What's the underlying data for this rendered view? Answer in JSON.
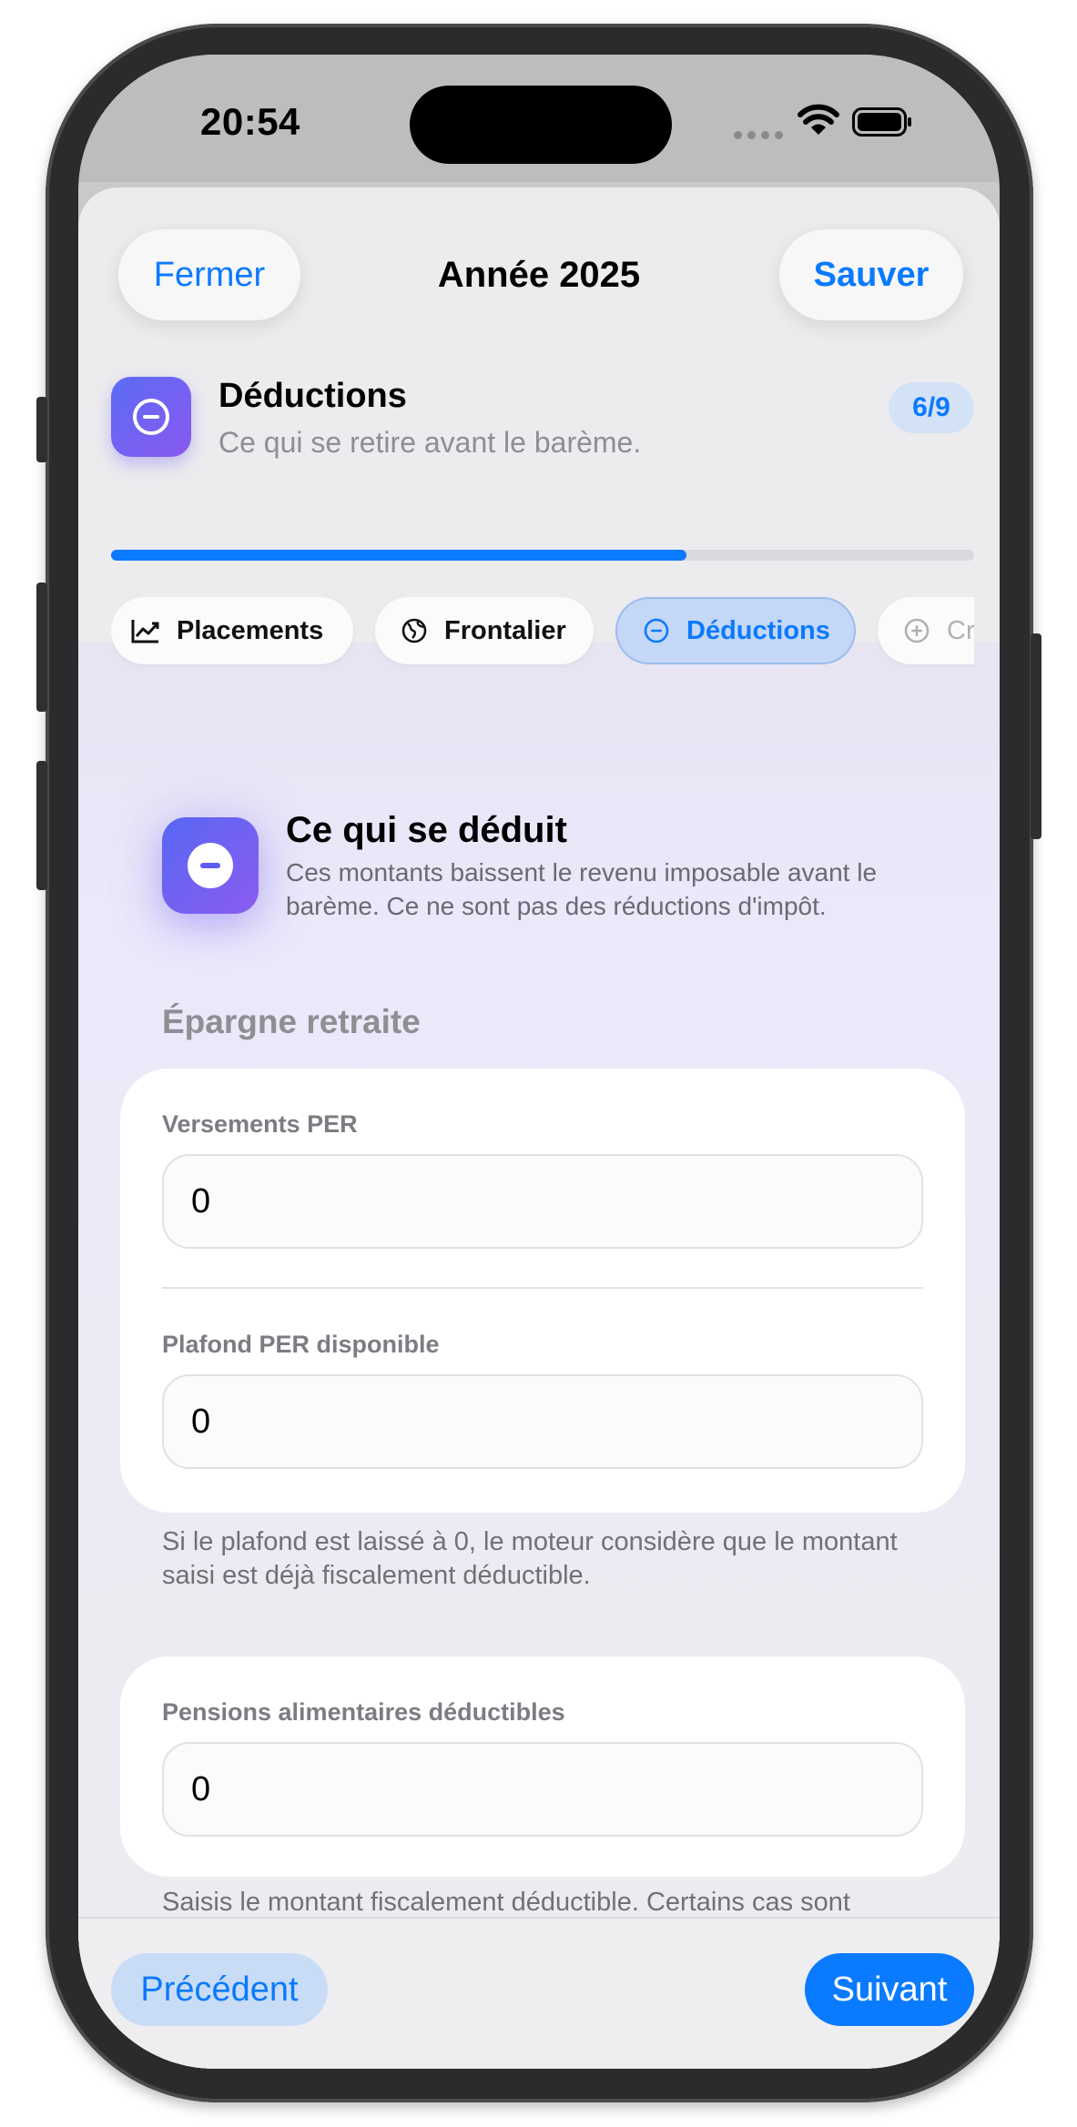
{
  "status_bar": {
    "time": "20:54"
  },
  "header": {
    "close_label": "Fermer",
    "title": "Année 2025",
    "save_label": "Sauver"
  },
  "section": {
    "title": "Déductions",
    "subtitle": "Ce qui se retire avant le barème.",
    "step_badge": "6/9",
    "progress": 0.667
  },
  "tabs": [
    {
      "label": "Placements",
      "icon": "chart-icon"
    },
    {
      "label": "Frontalier",
      "icon": "globe-icon"
    },
    {
      "label": "Déductions",
      "icon": "minus-circle-icon",
      "active": true
    },
    {
      "label": "Cr",
      "icon": "plus-circle-icon"
    }
  ],
  "intro": {
    "title": "Ce qui se déduit",
    "text": "Ces montants baissent le revenu imposable avant le barème. Ce ne sont pas des réductions d'impôt."
  },
  "group_retirement": {
    "label": "Épargne retraite",
    "fields": [
      {
        "label": "Versements PER",
        "value": "0"
      },
      {
        "label": "Plafond PER disponible",
        "value": "0"
      }
    ],
    "hint": "Si le plafond est laissé à 0, le moteur considère que le montant saisi est déjà fiscalement déductible."
  },
  "group_alimony": {
    "fields": [
      {
        "label": "Pensions alimentaires déductibles",
        "value": "0"
      }
    ],
    "hint": "Saisis le montant fiscalement déductible. Certains cas sont"
  },
  "footer": {
    "prev_label": "Précédent",
    "next_label": "Suivant"
  },
  "colors": {
    "accent": "#0a7aff",
    "icon_gradient_start": "#5b6cf5",
    "icon_gradient_end": "#8a58f0"
  }
}
